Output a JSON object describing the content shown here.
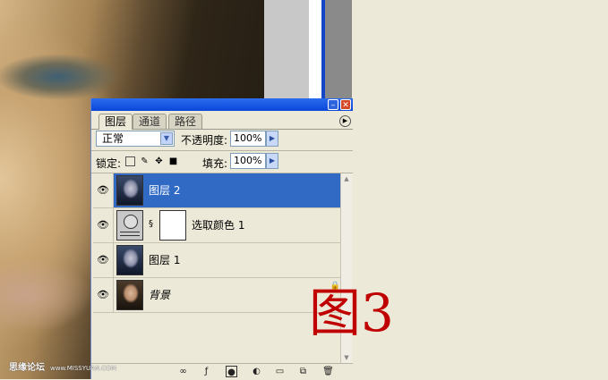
{
  "background": {
    "photo": "woman-portrait",
    "figure_label": "图3",
    "watermark": {
      "name": "思缘论坛",
      "url": "www.MISSYUAN.COM"
    }
  },
  "palette": {
    "tabs": [
      {
        "label": "图层",
        "active": true
      },
      {
        "label": "通道",
        "active": false
      },
      {
        "label": "路径",
        "active": false
      }
    ],
    "blend_mode": "正常",
    "opacity_label": "不透明度:",
    "opacity_value": "100%",
    "lock_label": "锁定:",
    "fill_label": "填充:",
    "fill_value": "100%",
    "layers": [
      {
        "name": "图层 2",
        "selected": true,
        "visible": true
      },
      {
        "name": "选取颜色 1",
        "selected": false,
        "visible": true,
        "adjustment": true
      },
      {
        "name": "图层 1",
        "selected": false,
        "visible": true
      },
      {
        "name": "背景",
        "selected": false,
        "visible": true,
        "locked": true
      }
    ]
  },
  "colors": {
    "selection": "#316ac5",
    "title_bar": "#0a46d8",
    "figure_label": "#c00000"
  }
}
